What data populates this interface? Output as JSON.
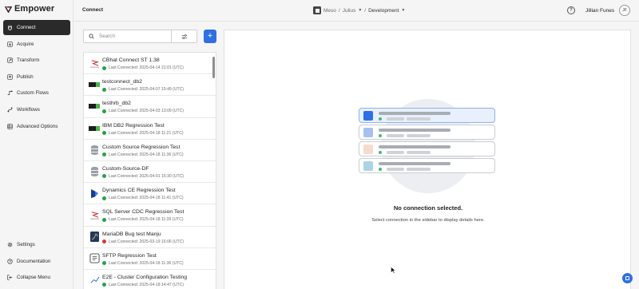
{
  "brand": {
    "name": "Empower"
  },
  "sidebar": {
    "items": [
      {
        "label": "Connect",
        "icon": "plug-icon",
        "active": true
      },
      {
        "label": "Acquire",
        "icon": "download-icon",
        "active": false
      },
      {
        "label": "Transform",
        "icon": "transform-icon",
        "active": false
      },
      {
        "label": "Publish",
        "icon": "publish-icon",
        "active": false
      },
      {
        "label": "Custom Flows",
        "icon": "flow-icon",
        "active": false
      },
      {
        "label": "Workflows",
        "icon": "workflow-icon",
        "active": false
      },
      {
        "label": "Advanced Options",
        "icon": "grid-icon",
        "active": false
      }
    ],
    "bottom": [
      {
        "label": "Settings",
        "icon": "gear-icon"
      },
      {
        "label": "Documentation",
        "icon": "help-icon"
      },
      {
        "label": "Collapse Menu",
        "icon": "collapse-icon"
      }
    ]
  },
  "header": {
    "title": "Connect",
    "breadcrumb": {
      "org": "Meso",
      "project": "Julius",
      "environment": "Development"
    },
    "user_name": "Jillian Funes",
    "user_initials": "JF",
    "help_glyph": "?"
  },
  "search": {
    "placeholder": "Search",
    "value": ""
  },
  "add_button": {
    "label": "+"
  },
  "connections": [
    {
      "name": "CBhat Connect ST 1.38",
      "status": "Last Connected: 2025-04-14 21:01 (UTC)",
      "ok": true,
      "icon": "sqlserver-icon"
    },
    {
      "name": "testconnect_db2",
      "status": "Last Connected: 2025-04-07 15:49 (UTC)",
      "ok": true,
      "icon": "db2-icon"
    },
    {
      "name": "testhrb_db2",
      "status": "Last Connected: 2025-04-03 13:09 (UTC)",
      "ok": true,
      "icon": "db2-icon"
    },
    {
      "name": "IBM DB2 Regression Test",
      "status": "Last Connected: 2025-04-18 11:21 (UTC)",
      "ok": true,
      "icon": "db2-icon"
    },
    {
      "name": "Custom Source Regression Test",
      "status": "Last Connected: 2025-04-18 11:36 (UTC)",
      "ok": true,
      "icon": "database-icon"
    },
    {
      "name": "Custom-Source-DF",
      "status": "Last Connected: 2025-04-01 15:30 (UTC)",
      "ok": true,
      "icon": "database-icon"
    },
    {
      "name": "Dynamics CE Regression Test",
      "status": "Last Connected: 2025-04-18 11:41 (UTC)",
      "ok": true,
      "icon": "dynamics-icon"
    },
    {
      "name": "SQL Server CDC Regression Test",
      "status": "Last Connected: 2025-04-18 11:39 (UTC)",
      "ok": true,
      "icon": "sqlserver-icon"
    },
    {
      "name": "MariaDB Bug test Manju",
      "status": "Last Connected: 2025-03-19 16:06 (UTC)",
      "ok": false,
      "icon": "mariadb-icon"
    },
    {
      "name": "SFTP Regression Test",
      "status": "Last Connected: 2025-04-18 11:36 (UTC)",
      "ok": true,
      "icon": "sftp-icon"
    },
    {
      "name": "E2E - Cluster Configuration Testing",
      "status": "Last Connected: 2025-04-18 14:47 (UTC)",
      "ok": true,
      "icon": "cluster-icon"
    }
  ],
  "detail": {
    "empty_title": "No connection selected.",
    "empty_subtitle": "Select connection in the sidebar to display details here."
  },
  "colors": {
    "accent": "#2f6fe4",
    "active_nav": "#2a2a2a",
    "status_ok": "#25a244",
    "status_error": "#d93737",
    "card_squares": [
      "#2f6fe4",
      "#a6c0f3",
      "#f7d9cf",
      "#add2e4"
    ]
  }
}
